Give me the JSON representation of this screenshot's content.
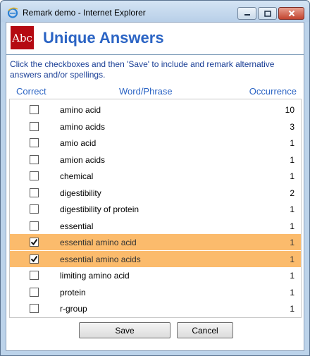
{
  "window": {
    "title": "Remark demo - Internet Explorer",
    "icon": "internet-explorer-icon",
    "controls": [
      "minimize-icon",
      "maximize-icon",
      "close-icon"
    ]
  },
  "header": {
    "logo_text": "Abc",
    "title": "Unique Answers"
  },
  "instructions": "Click the checkboxes and then 'Save' to include and remark alternative answers and/or spellings.",
  "columns": {
    "correct": "Correct",
    "word": "Word/Phrase",
    "occurrence": "Occurrence"
  },
  "rows": [
    {
      "word": "amino acid",
      "occurrence": "10",
      "checked": false
    },
    {
      "word": "amino acids",
      "occurrence": "3",
      "checked": false
    },
    {
      "word": "amio acid",
      "occurrence": "1",
      "checked": false
    },
    {
      "word": "amion acids",
      "occurrence": "1",
      "checked": false
    },
    {
      "word": "chemical",
      "occurrence": "1",
      "checked": false
    },
    {
      "word": "digestibility",
      "occurrence": "2",
      "checked": false
    },
    {
      "word": "digestibility of protein",
      "occurrence": "1",
      "checked": false
    },
    {
      "word": "essential",
      "occurrence": "1",
      "checked": false
    },
    {
      "word": "essential amino acid",
      "occurrence": "1",
      "checked": true
    },
    {
      "word": "essential amino acids",
      "occurrence": "1",
      "checked": true
    },
    {
      "word": "limiting amino acid",
      "occurrence": "1",
      "checked": false
    },
    {
      "word": "protein",
      "occurrence": "1",
      "checked": false
    },
    {
      "word": "r-group",
      "occurrence": "1",
      "checked": false
    }
  ],
  "buttons": {
    "save": "Save",
    "cancel": "Cancel"
  },
  "colors": {
    "accent": "#2b64c4",
    "selected_row": "#fbbb6c",
    "logo_bg": "#b50a12"
  }
}
